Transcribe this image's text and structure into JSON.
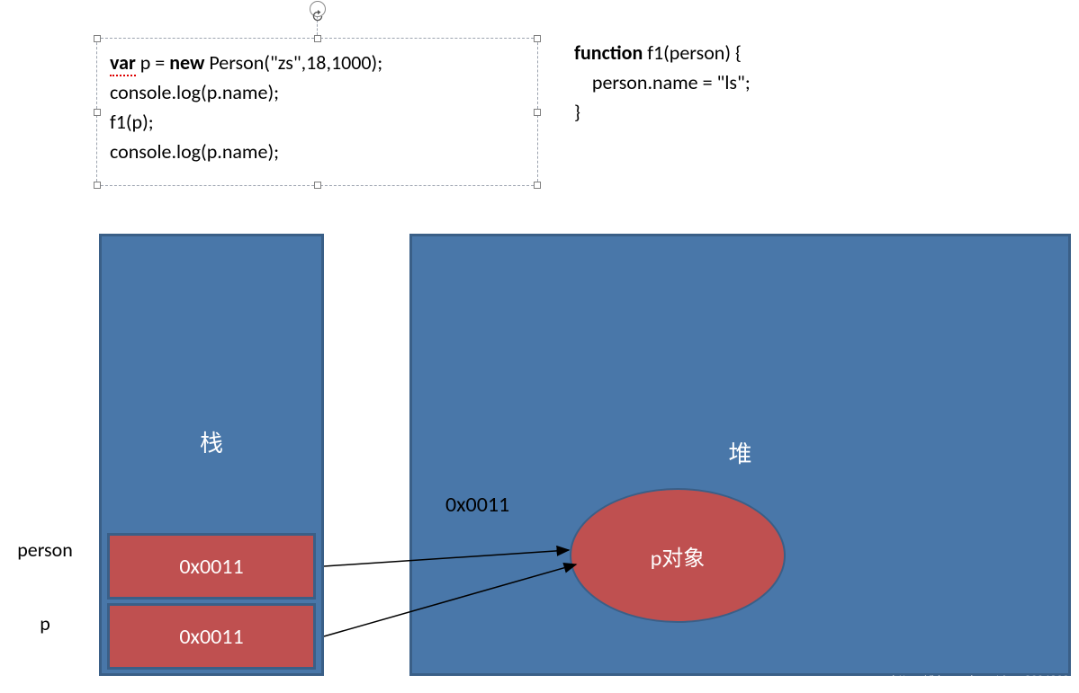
{
  "code_left": {
    "line1_var": "var",
    "line1_mid": " p = ",
    "line1_new": "new",
    "line1_rest": " Person(\"zs\",18,1000);",
    "line2": "console.log(p.name);",
    "line3": "f1(p);",
    "line4": "console.log(p.name);"
  },
  "code_right": {
    "line1_fn": "function",
    "line1_rest": " f1(person) {",
    "line2": "    person.name = \"ls\";",
    "line3": "}"
  },
  "stack": {
    "label": "栈",
    "slot_person": "0x0011",
    "slot_p": "0x0011",
    "label_person": "person",
    "label_p": "p"
  },
  "heap": {
    "label": "堆",
    "addr": "0x0011",
    "obj_label": "p对象"
  },
  "watermark": "https://blog.csdn.net/qq_39043923"
}
